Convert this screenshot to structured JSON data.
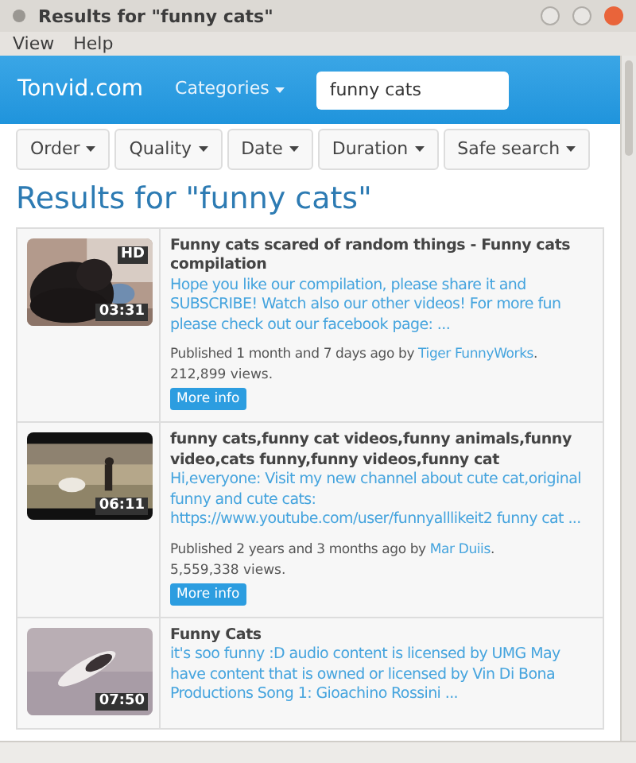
{
  "window": {
    "title": "Results for \"funny cats\""
  },
  "menu": [
    "View",
    "Help"
  ],
  "navbar": {
    "brand": "Tonvid.com",
    "categories": "Categories",
    "search": {
      "value": "funny cats"
    }
  },
  "filters": [
    "Order",
    "Quality",
    "Date",
    "Duration",
    "Safe search"
  ],
  "heading": "Results for \"funny cats\"",
  "results": [
    {
      "title": "Funny cats scared of random things - Funny cats compilation",
      "description": "Hope you like our compilation, please share it and SUBSCRIBE! Watch also our other videos! For more fun please check out our facebook page: ...",
      "published": "Published 1 month and 7 days ago by",
      "author": "Tiger FunnyWorks",
      "after": ".",
      "views": "212,899 views.",
      "button": "More info",
      "hd": "HD",
      "duration": "03:31"
    },
    {
      "title": "funny cats,funny cat videos,funny animals,funny video,cats funny,funny videos,funny cat",
      "description": "Hi,everyone: Visit my new channel about cute cat,original funny and cute cats: https://www.youtube.com/user/funnyalllikeit2 funny cat ...",
      "published": "Published 2 years and 3 months ago by",
      "author": "Mar Duiis",
      "after": ".",
      "views": "5,559,338 views.",
      "button": "More info",
      "duration": "06:11"
    },
    {
      "title": "Funny Cats",
      "description": "it's soo funny :D audio content is licensed by UMG May have content that is owned or licensed by Vin Di Bona Productions Song 1: Gioachino Rossini ...",
      "duration": "07:50"
    }
  ]
}
